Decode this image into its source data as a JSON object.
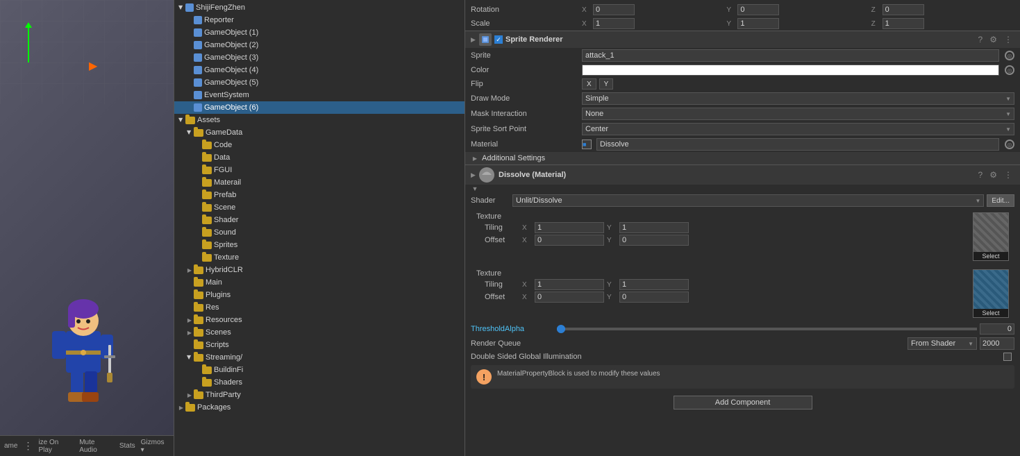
{
  "scene": {
    "bottomBar": {
      "name": "ame",
      "options": [
        "ize On Play",
        "Mute Audio",
        "Stats",
        "Gizmos"
      ]
    }
  },
  "hierarchy": {
    "items": [
      {
        "id": "shijifengzhen",
        "label": "ShijiFengZhen",
        "indent": 0,
        "type": "root",
        "expanded": true
      },
      {
        "id": "reporter",
        "label": "Reporter",
        "indent": 1,
        "type": "gameobj"
      },
      {
        "id": "gameobj1",
        "label": "GameObject (1)",
        "indent": 1,
        "type": "gameobj"
      },
      {
        "id": "gameobj2",
        "label": "GameObject (2)",
        "indent": 1,
        "type": "gameobj"
      },
      {
        "id": "gameobj3",
        "label": "GameObject (3)",
        "indent": 1,
        "type": "gameobj"
      },
      {
        "id": "gameobj4",
        "label": "GameObject (4)",
        "indent": 1,
        "type": "gameobj"
      },
      {
        "id": "gameobj5",
        "label": "GameObject (5)",
        "indent": 1,
        "type": "gameobj"
      },
      {
        "id": "eventsystem",
        "label": "EventSystem",
        "indent": 1,
        "type": "gameobj"
      },
      {
        "id": "gameobj6",
        "label": "GameObject (6)",
        "indent": 1,
        "type": "gameobj",
        "selected": true
      },
      {
        "id": "assets",
        "label": "Assets",
        "indent": 0,
        "type": "folder",
        "expanded": true
      },
      {
        "id": "gamedata",
        "label": "GameData",
        "indent": 1,
        "type": "folder",
        "expanded": true
      },
      {
        "id": "code",
        "label": "Code",
        "indent": 2,
        "type": "folder"
      },
      {
        "id": "data",
        "label": "Data",
        "indent": 2,
        "type": "folder"
      },
      {
        "id": "fgui",
        "label": "FGUI",
        "indent": 2,
        "type": "folder"
      },
      {
        "id": "material",
        "label": "Materail",
        "indent": 2,
        "type": "folder"
      },
      {
        "id": "prefab",
        "label": "Prefab",
        "indent": 2,
        "type": "folder",
        "expanded": false
      },
      {
        "id": "scene",
        "label": "Scene",
        "indent": 2,
        "type": "folder"
      },
      {
        "id": "shader",
        "label": "Shader",
        "indent": 2,
        "type": "folder"
      },
      {
        "id": "sound",
        "label": "Sound",
        "indent": 2,
        "type": "folder"
      },
      {
        "id": "sprites",
        "label": "Sprites",
        "indent": 2,
        "type": "folder",
        "expanded": false
      },
      {
        "id": "texture",
        "label": "Texture",
        "indent": 2,
        "type": "folder"
      },
      {
        "id": "hybridclr",
        "label": "HybridCLR",
        "indent": 1,
        "type": "folder",
        "expanded": false
      },
      {
        "id": "main",
        "label": "Main",
        "indent": 1,
        "type": "folder"
      },
      {
        "id": "plugins",
        "label": "Plugins",
        "indent": 1,
        "type": "folder"
      },
      {
        "id": "res",
        "label": "Res",
        "indent": 1,
        "type": "folder"
      },
      {
        "id": "resources",
        "label": "Resources",
        "indent": 1,
        "type": "folder",
        "expanded": false
      },
      {
        "id": "scenes",
        "label": "Scenes",
        "indent": 1,
        "type": "folder",
        "expanded": false
      },
      {
        "id": "scripts",
        "label": "Scripts",
        "indent": 1,
        "type": "folder"
      },
      {
        "id": "streaming",
        "label": "Streaming/",
        "indent": 1,
        "type": "folder",
        "expanded": true
      },
      {
        "id": "buildinfi",
        "label": "BuildinFi",
        "indent": 2,
        "type": "folder"
      },
      {
        "id": "shaders",
        "label": "Shaders",
        "indent": 2,
        "type": "folder"
      },
      {
        "id": "thirdparty",
        "label": "ThirdParty",
        "indent": 1,
        "type": "folder",
        "expanded": false
      },
      {
        "id": "packages",
        "label": "Packages",
        "indent": 0,
        "type": "folder",
        "expanded": false
      }
    ]
  },
  "inspector": {
    "transform": {
      "rotation": {
        "label": "Rotation",
        "x_label": "X",
        "x_val": "0",
        "y_label": "Y",
        "y_val": "0",
        "z_label": "Z",
        "z_val": "0"
      },
      "scale": {
        "label": "Scale",
        "x_label": "X",
        "x_val": "1",
        "y_label": "Y",
        "y_val": "1",
        "z_label": "Z",
        "z_val": "1"
      }
    },
    "spriteRenderer": {
      "title": "Sprite Renderer",
      "sprite_label": "Sprite",
      "sprite_value": "attack_1",
      "color_label": "Color",
      "flip_label": "Flip",
      "flip_x": "X",
      "flip_y": "Y",
      "draw_mode_label": "Draw Mode",
      "draw_mode_value": "Simple",
      "mask_interaction_label": "Mask Interaction",
      "mask_interaction_value": "None",
      "sprite_sort_point_label": "Sprite Sort Point",
      "sprite_sort_point_value": "Center",
      "material_label": "Material",
      "material_value": "Dissolve",
      "additional_settings_label": "Additional Settings"
    },
    "material": {
      "title": "Dissolve (Material)",
      "shader_label": "Shader",
      "shader_value": "Unlit/Dissolve",
      "edit_btn": "Edit...",
      "texture1": {
        "title": "Texture",
        "tiling_label": "Tiling",
        "tiling_x_label": "X",
        "tiling_x_val": "1",
        "tiling_y_label": "Y",
        "tiling_y_val": "1",
        "offset_label": "Offset",
        "offset_x_label": "X",
        "offset_x_val": "0",
        "offset_y_label": "Y",
        "offset_y_val": "0",
        "select_label": "Select"
      },
      "texture2": {
        "title": "Texture",
        "tiling_label": "Tiling",
        "tiling_x_label": "X",
        "tiling_x_val": "1",
        "tiling_y_label": "Y",
        "tiling_y_val": "1",
        "offset_label": "Offset",
        "offset_x_label": "X",
        "offset_x_val": "0",
        "offset_y_label": "Y",
        "offset_y_val": "0",
        "select_label": "Select"
      },
      "threshold_label": "ThresholdAlpha",
      "threshold_val": "0",
      "render_queue_label": "Render Queue",
      "render_queue_option": "From Shader",
      "render_queue_num": "2000",
      "double_sided_label": "Double Sided Global Illumination",
      "warning_text": "MaterialPropertyBlock is used to modify these values"
    },
    "addComponent": "Add Component"
  }
}
